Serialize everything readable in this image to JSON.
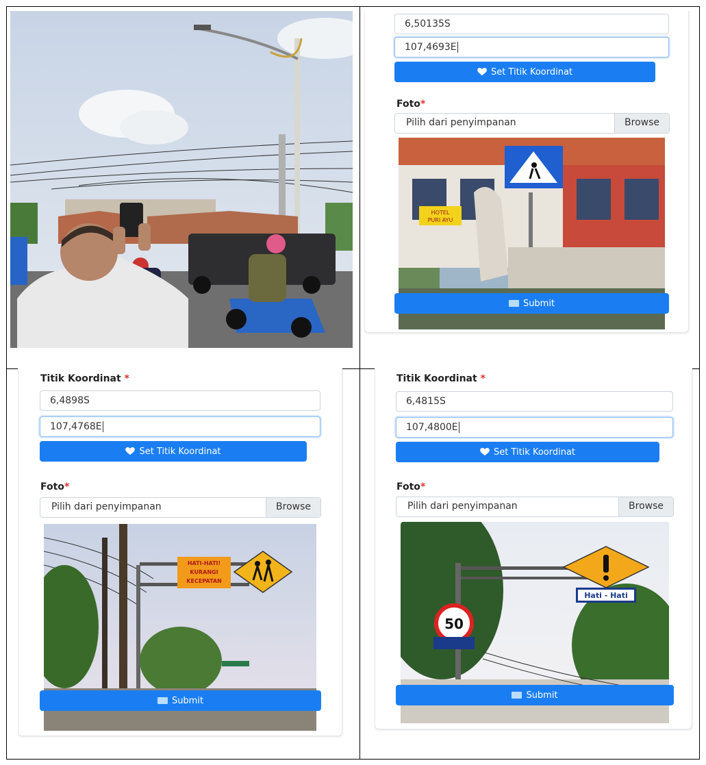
{
  "panel_b": {
    "lat_value": "6,50135S",
    "lng_value": "107,4693E",
    "set_button": "Set Titik Koordinat",
    "foto_label": "Foto",
    "file_placeholder": "Pilih dari penyimpanan",
    "browse": "Browse",
    "submit": "Submit",
    "sign_text_1": "HOTEL",
    "sign_text_2": "PURI AYU"
  },
  "panel_c": {
    "coord_label": "Titik Koordinat",
    "lat_value": "6,4898S",
    "lng_value": "107,4768E",
    "set_button": "Set Titik Koordinat",
    "foto_label": "Foto",
    "file_placeholder": "Pilih dari penyimpanan",
    "browse": "Browse",
    "submit": "Submit",
    "sign_text_1": "HATI-HATI!",
    "sign_text_2": "KURANGI",
    "sign_text_3": "KECEPATAN"
  },
  "panel_d": {
    "coord_label": "Titik Koordinat",
    "lat_value": "6,4815S",
    "lng_value": "107,4800E",
    "set_button": "Set Titik Koordinat",
    "foto_label": "Foto",
    "file_placeholder": "Pilih dari penyimpanan",
    "browse": "Browse",
    "submit": "Submit",
    "sign_text_1": "Hati - Hati",
    "speed_limit": "50"
  },
  "required_mark": "*",
  "colors": {
    "primary": "#1a7ef2",
    "required": "#e03131"
  }
}
